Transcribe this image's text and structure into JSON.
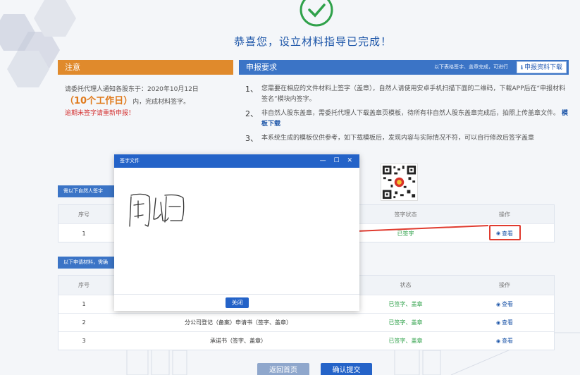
{
  "header": {
    "success_title": "恭喜您，设立材料指导已完成！"
  },
  "notice": {
    "title": "注意",
    "line1": "请委托代理人通知各股东于：2020年10月12日",
    "deadline": "（10个工作日）",
    "line2": "内，完成材料签字。",
    "warning": "逾期未签字请重新申报！"
  },
  "requirements": {
    "title": "申报要求",
    "hint": "以下表格签字、盖章完成，可进行",
    "download_label": "申报资料下载",
    "items": [
      {
        "num": "1、",
        "text": "您需要在相应的文件材料上签字（盖章），自然人请使用安卓手机扫描下面的二维码，下载APP后在“申报材料签名”模块内签字。"
      },
      {
        "num": "2、",
        "text": "非自然人股东盖章，需委托代理人下载盖章页模板，待所有非自然人股东盖章完成后，拍照上传盖章文件。",
        "link": "模板下载"
      },
      {
        "num": "3、",
        "text": "本系统生成的模板仅供参考，如下载模板后，发现内容与实际情况不符，可以自行修改后签字盖章"
      }
    ]
  },
  "table1": {
    "tag": "需以下自然人签字",
    "headers": {
      "seq": "序号",
      "status": "签字状态",
      "op": "操作"
    },
    "rows": [
      {
        "seq": "1",
        "status": "已签字",
        "op": "查看"
      }
    ]
  },
  "table2": {
    "tag": "以下申请材料，需确",
    "headers": {
      "seq": "序号",
      "status": "状态",
      "op": "操作"
    },
    "rows": [
      {
        "seq": "1",
        "name": "",
        "status": "已签字、盖章",
        "op": "查看"
      },
      {
        "seq": "2",
        "name": "分公司登记（备案）申请书（签字、盖章）",
        "status": "已签字、盖章",
        "op": "查看"
      },
      {
        "seq": "3",
        "name": "承诺书（签字、盖章）",
        "status": "已签字、盖章",
        "op": "查看"
      }
    ]
  },
  "dialog": {
    "title": "签字文件",
    "controls": "— ☐ ✕",
    "close_label": "关闭"
  },
  "footer": {
    "back_label": "返回首页",
    "submit_label": "确认提交"
  },
  "colors": {
    "primary": "#2463c8",
    "notice": "#e08a2c",
    "success": "#2fa14a",
    "alert": "#e03b2f"
  }
}
